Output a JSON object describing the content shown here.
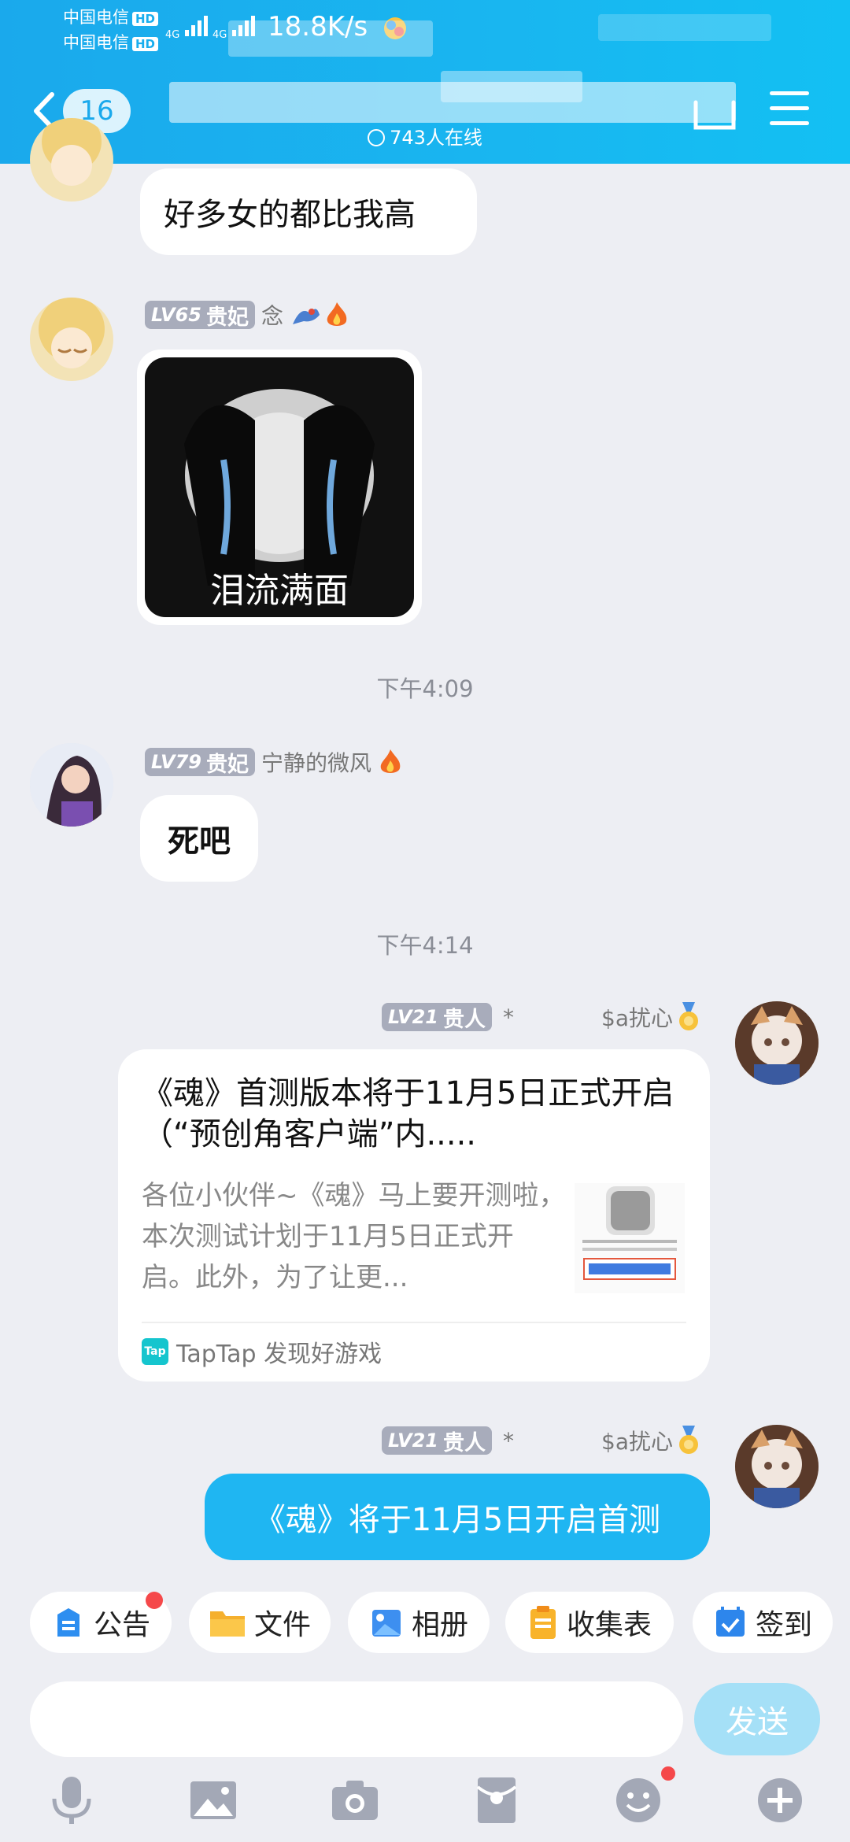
{
  "status_bar": {
    "carrier_1": "中国电信",
    "carrier_2": "中国电信",
    "hd": "HD",
    "network_1": "4G",
    "network_2": "4G",
    "speed": "18.8K/s"
  },
  "header": {
    "unread_count": "16",
    "online_text": "743人在线"
  },
  "messages": [
    {
      "text": "好多女的都比我高"
    },
    {
      "level": "LV65",
      "title": "贵妃",
      "nickname": "念",
      "sticker_caption": "泪流满面"
    },
    {
      "time": "下午4:09"
    },
    {
      "level": "LV79",
      "title": "贵妃",
      "nickname": "宁静的微风",
      "text": "死吧"
    },
    {
      "time": "下午4:14"
    },
    {
      "level": "LV21",
      "title": "贵人",
      "separator": "*",
      "nickname": "$a扰心",
      "card_title": "《魂》首测版本将于11月5日正式开启（“预创角客户端”内.....",
      "card_desc": "各位小伙伴~《魂》马上要开测啦，本次测试计划于11月5日正式开启。此外，为了让更...",
      "card_logo": "Tap",
      "card_source": "TapTap 发现好游戏"
    },
    {
      "level": "LV21",
      "title": "贵人",
      "separator": "*",
      "nickname": "$a扰心",
      "text": "《魂》将于11月5日开启首测"
    }
  ],
  "tools": [
    {
      "label": "公告",
      "icon": "announcement-icon"
    },
    {
      "label": "文件",
      "icon": "folder-icon"
    },
    {
      "label": "相册",
      "icon": "album-icon"
    },
    {
      "label": "收集表",
      "icon": "form-icon"
    },
    {
      "label": "签到",
      "icon": "checkin-icon"
    }
  ],
  "input": {
    "value": "",
    "send_label": "发送"
  },
  "bottom_bar": [
    "microphone-icon",
    "image-icon",
    "camera-icon",
    "red-packet-icon",
    "emoji-icon",
    "plus-icon"
  ],
  "colors": {
    "header": "#19b0ee",
    "self_bubble": "#1fb6f2",
    "send_disabled": "#a5e0f7",
    "level_tag": "#a8acbb"
  }
}
